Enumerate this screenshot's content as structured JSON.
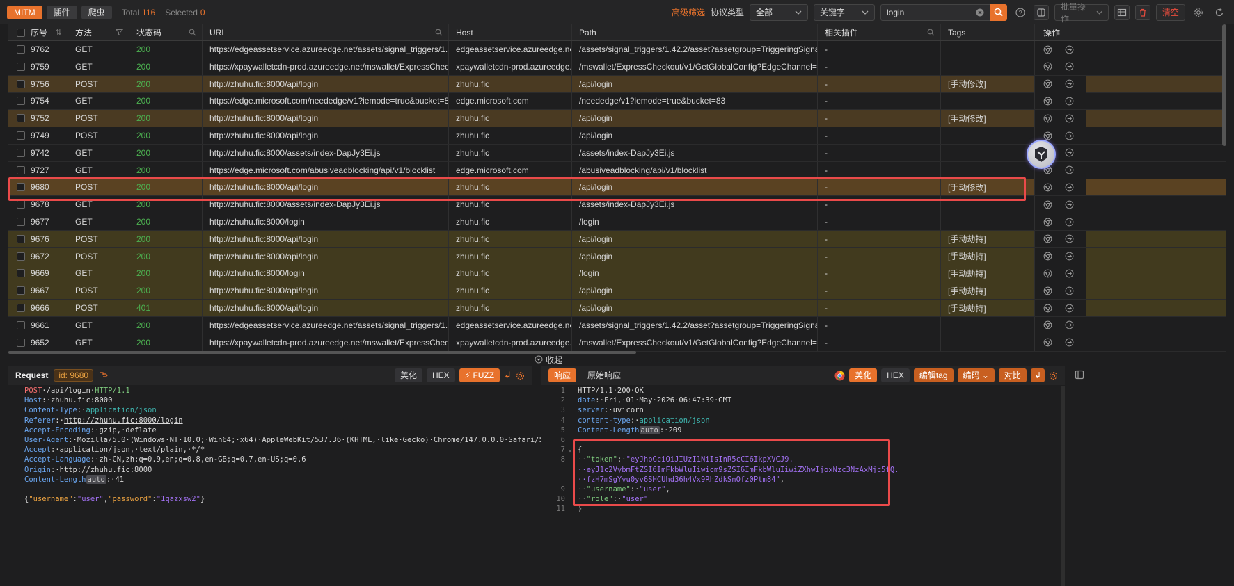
{
  "toolbar": {
    "modes": [
      "MITM",
      "插件",
      "爬虫"
    ],
    "total_label": "Total",
    "total_value": "116",
    "selected_label": "Selected",
    "selected_value": "0",
    "advanced_filter": "高级筛选",
    "protocol_label": "协议类型",
    "protocol_value": "全部",
    "search_mode": "关键字",
    "search_value": "login",
    "batch_label": "批量操作",
    "clear_label": "清空"
  },
  "table": {
    "columns": [
      "序号",
      "方法",
      "状态码",
      "URL",
      "Host",
      "Path",
      "相关插件",
      "Tags",
      "操作"
    ],
    "rows": [
      {
        "id": "9762",
        "method": "GET",
        "status": "200",
        "url": "https://edgeassetservice.azureedge.net/assets/signal_triggers/1.42.2/...",
        "host": "edgeassetservice.azureedge.net",
        "path": "/assets/signal_triggers/1.42.2/asset?assetgroup=TriggeringSignals",
        "plugin": "-",
        "tags": "",
        "style": "plain"
      },
      {
        "id": "9759",
        "method": "GET",
        "status": "200",
        "url": "https://xpaywalletcdn-prod.azureedge.net/mswallet/ExpressCheckou...",
        "host": "xpaywalletcdn-prod.azureedge....",
        "path": "/mswallet/ExpressCheckout/v1/GetGlobalConfig?EdgeChannel=stabl...",
        "plugin": "-",
        "tags": "",
        "style": "plain"
      },
      {
        "id": "9756",
        "method": "POST",
        "status": "200",
        "url": "http://zhuhu.fic:8000/api/login",
        "host": "zhuhu.fic",
        "path": "/api/login",
        "plugin": "-",
        "tags": "[手动修改]",
        "style": "tint"
      },
      {
        "id": "9754",
        "method": "GET",
        "status": "200",
        "url": "https://edge.microsoft.com/neededge/v1?iemode=true&bucket=83",
        "host": "edge.microsoft.com",
        "path": "/neededge/v1?iemode=true&bucket=83",
        "plugin": "-",
        "tags": "",
        "style": "plain"
      },
      {
        "id": "9752",
        "method": "POST",
        "status": "200",
        "url": "http://zhuhu.fic:8000/api/login",
        "host": "zhuhu.fic",
        "path": "/api/login",
        "plugin": "-",
        "tags": "[手动修改]",
        "style": "tint"
      },
      {
        "id": "9749",
        "method": "POST",
        "status": "200",
        "url": "http://zhuhu.fic:8000/api/login",
        "host": "zhuhu.fic",
        "path": "/api/login",
        "plugin": "-",
        "tags": "",
        "style": "plain"
      },
      {
        "id": "9742",
        "method": "GET",
        "status": "200",
        "url": "http://zhuhu.fic:8000/assets/index-DapJy3Ei.js",
        "host": "zhuhu.fic",
        "path": "/assets/index-DapJy3Ei.js",
        "plugin": "-",
        "tags": "",
        "style": "plain"
      },
      {
        "id": "9727",
        "method": "GET",
        "status": "200",
        "url": "https://edge.microsoft.com/abusiveadblocking/api/v1/blocklist",
        "host": "edge.microsoft.com",
        "path": "/abusiveadblocking/api/v1/blocklist",
        "plugin": "-",
        "tags": "",
        "style": "plain"
      },
      {
        "id": "9680",
        "method": "POST",
        "status": "200",
        "url": "http://zhuhu.fic:8000/api/login",
        "host": "zhuhu.fic",
        "path": "/api/login",
        "plugin": "-",
        "tags": "[手动修改]",
        "style": "sel"
      },
      {
        "id": "9678",
        "method": "GET",
        "status": "200",
        "url": "http://zhuhu.fic:8000/assets/index-DapJy3Ei.js",
        "host": "zhuhu.fic",
        "path": "/assets/index-DapJy3Ei.js",
        "plugin": "-",
        "tags": "",
        "style": "plain"
      },
      {
        "id": "9677",
        "method": "GET",
        "status": "200",
        "url": "http://zhuhu.fic:8000/login",
        "host": "zhuhu.fic",
        "path": "/login",
        "plugin": "-",
        "tags": "",
        "style": "plain"
      },
      {
        "id": "9676",
        "method": "POST",
        "status": "200",
        "url": "http://zhuhu.fic:8000/api/login",
        "host": "zhuhu.fic",
        "path": "/api/login",
        "plugin": "-",
        "tags": "[手动劫持]",
        "style": "tint2"
      },
      {
        "id": "9672",
        "method": "POST",
        "status": "200",
        "url": "http://zhuhu.fic:8000/api/login",
        "host": "zhuhu.fic",
        "path": "/api/login",
        "plugin": "-",
        "tags": "[手动劫持]",
        "style": "tint2"
      },
      {
        "id": "9669",
        "method": "GET",
        "status": "200",
        "url": "http://zhuhu.fic:8000/login",
        "host": "zhuhu.fic",
        "path": "/login",
        "plugin": "-",
        "tags": "[手动劫持]",
        "style": "tint2"
      },
      {
        "id": "9667",
        "method": "POST",
        "status": "200",
        "url": "http://zhuhu.fic:8000/api/login",
        "host": "zhuhu.fic",
        "path": "/api/login",
        "plugin": "-",
        "tags": "[手动劫持]",
        "style": "tint2"
      },
      {
        "id": "9666",
        "method": "POST",
        "status": "401",
        "url": "http://zhuhu.fic:8000/api/login",
        "host": "zhuhu.fic",
        "path": "/api/login",
        "plugin": "-",
        "tags": "[手动劫持]",
        "style": "tint2"
      },
      {
        "id": "9661",
        "method": "GET",
        "status": "200",
        "url": "https://edgeassetservice.azureedge.net/assets/signal_triggers/1.42.2/...",
        "host": "edgeassetservice.azureedge.net",
        "path": "/assets/signal_triggers/1.42.2/asset?assetgroup=TriggeringSignals",
        "plugin": "-",
        "tags": "",
        "style": "plain"
      },
      {
        "id": "9652",
        "method": "GET",
        "status": "200",
        "url": "https://xpaywalletcdn-prod.azureedge.net/mswallet/ExpressCheckou...",
        "host": "xpaywalletcdn-prod.azureedge....",
        "path": "/mswallet/ExpressCheckout/v1/GetGlobalConfig?EdgeChannel=stabl...",
        "plugin": "-",
        "tags": "",
        "style": "plain"
      }
    ]
  },
  "collapse_label": "收起",
  "request": {
    "title": "Request",
    "id_badge": "id: 9680",
    "buttons": [
      "美化",
      "HEX",
      "FUZZ"
    ],
    "lines": [
      [
        {
          "t": "POST",
          "c": "k-red"
        },
        {
          "t": "·/api/login·",
          "c": "k-plain"
        },
        {
          "t": "HTTP/1.1",
          "c": "k-grn"
        }
      ],
      [
        {
          "t": "Host",
          "c": "k-blu"
        },
        {
          "t": ":·zhuhu.fic:8000",
          "c": "k-plain"
        }
      ],
      [
        {
          "t": "Content-Type",
          "c": "k-blu"
        },
        {
          "t": ":·",
          "c": "k-plain"
        },
        {
          "t": "application/json",
          "c": "k-teal"
        }
      ],
      [
        {
          "t": "Referer",
          "c": "k-blu"
        },
        {
          "t": ":·",
          "c": "k-plain"
        },
        {
          "t": "http://zhuhu.fic:8000/login",
          "c": "k-plain u"
        }
      ],
      [
        {
          "t": "Accept-Encoding",
          "c": "k-blu"
        },
        {
          "t": ":·gzip,·deflate",
          "c": "k-plain"
        }
      ],
      [
        {
          "t": "User-Agent",
          "c": "k-blu"
        },
        {
          "t": ":·Mozilla/5.0·(Windows·NT·10.0;·Win64;·x64)·AppleWebKit/537.36·(KHTML,·like·Gecko)·Chrome/147.0.0.0·Safari/537.36",
          "c": "k-plain"
        }
      ],
      [
        {
          "t": "Accept",
          "c": "k-blu"
        },
        {
          "t": ":·application/json,·text/plain,·*/*",
          "c": "k-plain"
        }
      ],
      [
        {
          "t": "Accept-Language",
          "c": "k-blu"
        },
        {
          "t": ":·zh-CN,zh;q=0.9,en;q=0.8,en-GB;q=0.7,en-US;q=0.6",
          "c": "k-plain"
        }
      ],
      [
        {
          "t": "Origin",
          "c": "k-blu"
        },
        {
          "t": ":·",
          "c": "k-plain"
        },
        {
          "t": "http://zhuhu.fic:8000",
          "c": "k-plain u"
        }
      ],
      [
        {
          "t": "Content-Length",
          "c": "k-blu"
        },
        {
          "t": "auto",
          "c": "auto"
        },
        {
          "t": ":·41",
          "c": "k-plain"
        }
      ],
      [
        {
          "t": "",
          "c": "k-plain"
        }
      ],
      [
        {
          "t": "{",
          "c": "k-plain"
        },
        {
          "t": "\"username\"",
          "c": "k-org"
        },
        {
          "t": ":",
          "c": "k-plain"
        },
        {
          "t": "\"user\"",
          "c": "k-purp"
        },
        {
          "t": ",",
          "c": "k-plain"
        },
        {
          "t": "\"password\"",
          "c": "k-org"
        },
        {
          "t": ":",
          "c": "k-plain"
        },
        {
          "t": "\"1qazxsw2\"",
          "c": "k-purp"
        },
        {
          "t": "}",
          "c": "k-plain"
        }
      ]
    ]
  },
  "response": {
    "tabs": [
      "响应",
      "原始响应"
    ],
    "buttons": [
      "美化",
      "HEX",
      "编辑tag",
      "编码",
      "对比"
    ],
    "line_numbers": [
      "1",
      "2",
      "3",
      "4",
      "5",
      "6",
      "7",
      "8",
      "",
      "",
      "9",
      "10",
      "11"
    ],
    "lines": [
      [
        {
          "t": "HTTP/1.1·200·OK",
          "c": "k-plain"
        }
      ],
      [
        {
          "t": "date",
          "c": "k-blu"
        },
        {
          "t": ":·Fri,·01·May·2026·06:47:39·GMT",
          "c": "k-plain"
        }
      ],
      [
        {
          "t": "server",
          "c": "k-blu"
        },
        {
          "t": ":·uvicorn",
          "c": "k-plain"
        }
      ],
      [
        {
          "t": "content-type",
          "c": "k-blu"
        },
        {
          "t": ":·",
          "c": "k-plain"
        },
        {
          "t": "application/json",
          "c": "k-teal"
        }
      ],
      [
        {
          "t": "Content-Length",
          "c": "k-blu"
        },
        {
          "t": "auto",
          "c": "auto"
        },
        {
          "t": ":·209",
          "c": "k-plain"
        }
      ],
      [
        {
          "t": "",
          "c": "k-plain"
        }
      ],
      [
        {
          "t": "{",
          "c": "k-plain"
        }
      ],
      [
        {
          "t": "··",
          "c": "dot"
        },
        {
          "t": "\"token\"",
          "c": "k-grn"
        },
        {
          "t": ":·",
          "c": "k-plain"
        },
        {
          "t": "\"eyJhbGciOiJIUzI1NiIsInR5cCI6IkpXVCJ9.",
          "c": "k-purp"
        }
      ],
      [
        {
          "t": "··eyJ1c2VybmFtZSI6ImFkbWluIiwicm9sZSI6ImFkbWluIiwiZXhwIjoxNzc3NzAxMjc5fQ.",
          "c": "k-purp"
        }
      ],
      [
        {
          "t": "··fzH7mSgYvu0yv6SHCUhd36h4Vx9RhZdkSnOfz0Ptm84\"",
          "c": "k-purp"
        },
        {
          "t": ",",
          "c": "k-plain"
        }
      ],
      [
        {
          "t": "··",
          "c": "dot"
        },
        {
          "t": "\"username\"",
          "c": "k-grn"
        },
        {
          "t": ":·",
          "c": "k-plain"
        },
        {
          "t": "\"user\"",
          "c": "k-purp"
        },
        {
          "t": ",",
          "c": "k-plain"
        }
      ],
      [
        {
          "t": "··",
          "c": "dot"
        },
        {
          "t": "\"role\"",
          "c": "k-grn"
        },
        {
          "t": ":·",
          "c": "k-plain"
        },
        {
          "t": "\"user\"",
          "c": "k-purp"
        }
      ],
      [
        {
          "t": "}",
          "c": "k-plain"
        }
      ]
    ]
  },
  "colors": {
    "accent": "#e8722c",
    "status_ok": "#4cb050",
    "highlight": "#ea4a4a"
  },
  "icons": {
    "sort": "sort-icon",
    "filter": "filter-icon",
    "search": "search-icon",
    "chrome": "chrome-icon",
    "go": "arrow-circle-icon"
  }
}
